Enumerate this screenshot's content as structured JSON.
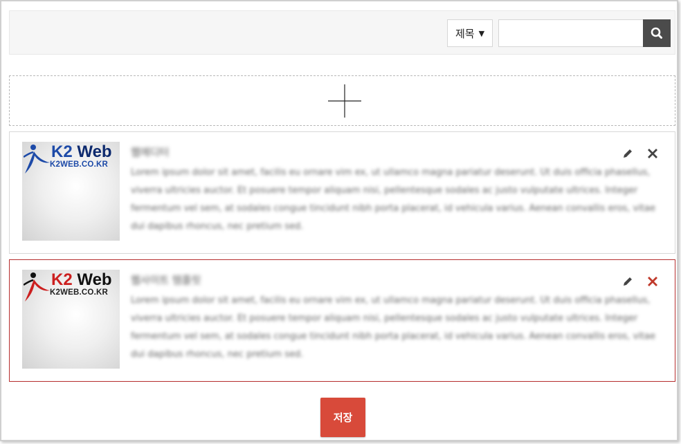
{
  "search": {
    "field_select": "제목",
    "input_value": "",
    "input_placeholder": ""
  },
  "add_box": {
    "icon": "plus-icon"
  },
  "items": [
    {
      "logo_title_k2": "K2",
      "logo_title_web": "Web",
      "logo_sub": "K2WEB.CO.KR",
      "title": "웹에디터",
      "description": "Lorem ipsum dolor sit amet, facilis eu ornare vim ex, ut ullamco magna pariatur deserunt. Ut duis officia phasellus, viverra ultricies auctor. Et posuere tempor aliquam nisi, pellentesque sodales ac justo vulputate ultrices. Integer fermentum vel sem, at sodales congue tincidunt nibh porta placerat, id vehicula varius. Aenean convallis eros, vitae dui dapibus rhoncus, nec pretium sed.",
      "selected": false,
      "edit_icon": "pencil-icon",
      "delete_icon": "close-icon"
    },
    {
      "logo_title_k2": "K2",
      "logo_title_web": "Web",
      "logo_sub": "K2WEB.CO.KR",
      "title": "웹사이트 템플릿",
      "description": "Lorem ipsum dolor sit amet, facilis eu ornare vim ex, ut ullamco magna pariatur deserunt. Ut duis officia phasellus, viverra ultricies auctor. Et posuere tempor aliquam nisi, pellentesque sodales ac justo vulputate ultrices. Integer fermentum vel sem, at sodales congue tincidunt nibh porta placerat, id vehicula varius. Aenean convallis eros, vitae dui dapibus rhoncus, nec pretium sed.",
      "selected": true,
      "edit_icon": "pencil-icon",
      "delete_icon": "close-icon"
    }
  ],
  "save_label": "저장",
  "colors": {
    "accent": "#d84a3a",
    "selected_border": "#b52c2c",
    "delete_active": "#c0392b",
    "search_button": "#4b4b4b"
  }
}
